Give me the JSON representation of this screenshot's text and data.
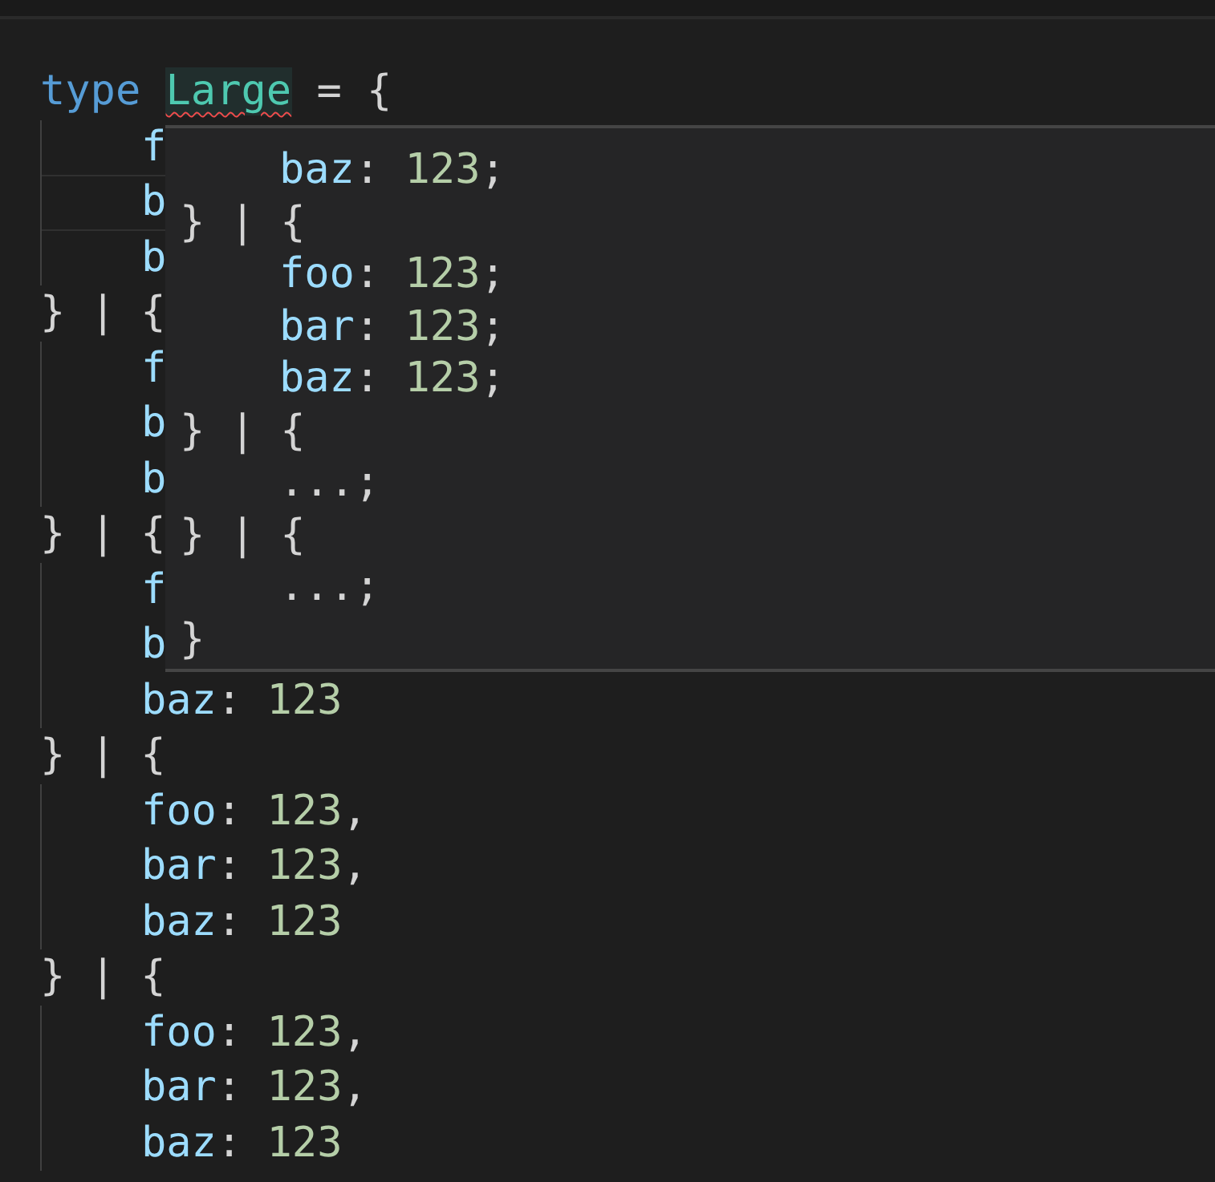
{
  "editor": {
    "lines": [
      {
        "indent": false,
        "tokens": [
          {
            "kind": "keyword",
            "text": "type "
          },
          {
            "kind": "type",
            "text": "Large",
            "highlighted": true,
            "error": true
          },
          {
            "kind": "punct",
            "text": " = {"
          }
        ]
      },
      {
        "indent": true,
        "tokens": [
          {
            "kind": "prop",
            "text": "f"
          }
        ]
      },
      {
        "indent": true,
        "current": true,
        "tokens": [
          {
            "kind": "prop",
            "text": "b"
          }
        ]
      },
      {
        "indent": true,
        "tokens": [
          {
            "kind": "prop",
            "text": "b"
          }
        ]
      },
      {
        "indent": false,
        "tokens": [
          {
            "kind": "punct",
            "text": "} | {"
          }
        ]
      },
      {
        "indent": true,
        "tokens": [
          {
            "kind": "prop",
            "text": "f"
          }
        ]
      },
      {
        "indent": true,
        "tokens": [
          {
            "kind": "prop",
            "text": "b"
          }
        ]
      },
      {
        "indent": true,
        "tokens": [
          {
            "kind": "prop",
            "text": "b"
          }
        ]
      },
      {
        "indent": false,
        "tokens": [
          {
            "kind": "punct",
            "text": "} | {"
          }
        ]
      },
      {
        "indent": true,
        "tokens": [
          {
            "kind": "prop",
            "text": "f"
          }
        ]
      },
      {
        "indent": true,
        "tokens": [
          {
            "kind": "prop",
            "text": "b"
          }
        ]
      },
      {
        "indent": true,
        "tokens": [
          {
            "kind": "prop",
            "text": "baz"
          },
          {
            "kind": "punct",
            "text": ": "
          },
          {
            "kind": "number",
            "text": "123"
          }
        ]
      },
      {
        "indent": false,
        "tokens": [
          {
            "kind": "punct",
            "text": "} | {"
          }
        ]
      },
      {
        "indent": true,
        "tokens": [
          {
            "kind": "prop",
            "text": "foo"
          },
          {
            "kind": "punct",
            "text": ": "
          },
          {
            "kind": "number",
            "text": "123"
          },
          {
            "kind": "punct",
            "text": ","
          }
        ]
      },
      {
        "indent": true,
        "tokens": [
          {
            "kind": "prop",
            "text": "bar"
          },
          {
            "kind": "punct",
            "text": ": "
          },
          {
            "kind": "number",
            "text": "123"
          },
          {
            "kind": "punct",
            "text": ","
          }
        ]
      },
      {
        "indent": true,
        "tokens": [
          {
            "kind": "prop",
            "text": "baz"
          },
          {
            "kind": "punct",
            "text": ": "
          },
          {
            "kind": "number",
            "text": "123"
          }
        ]
      },
      {
        "indent": false,
        "tokens": [
          {
            "kind": "punct",
            "text": "} | {"
          }
        ]
      },
      {
        "indent": true,
        "tokens": [
          {
            "kind": "prop",
            "text": "foo"
          },
          {
            "kind": "punct",
            "text": ": "
          },
          {
            "kind": "number",
            "text": "123"
          },
          {
            "kind": "punct",
            "text": ","
          }
        ]
      },
      {
        "indent": true,
        "tokens": [
          {
            "kind": "prop",
            "text": "bar"
          },
          {
            "kind": "punct",
            "text": ": "
          },
          {
            "kind": "number",
            "text": "123"
          },
          {
            "kind": "punct",
            "text": ","
          }
        ]
      },
      {
        "indent": true,
        "tokens": [
          {
            "kind": "prop",
            "text": "baz"
          },
          {
            "kind": "punct",
            "text": ": "
          },
          {
            "kind": "number",
            "text": "123"
          }
        ]
      }
    ]
  },
  "hover": {
    "lines": [
      {
        "indent": true,
        "tokens": [
          {
            "kind": "prop",
            "text": "baz"
          },
          {
            "kind": "punct",
            "text": ": "
          },
          {
            "kind": "number",
            "text": "123"
          },
          {
            "kind": "punct",
            "text": ";"
          }
        ]
      },
      {
        "indent": false,
        "tokens": [
          {
            "kind": "punct",
            "text": "} | {"
          }
        ]
      },
      {
        "indent": true,
        "tokens": [
          {
            "kind": "prop",
            "text": "foo"
          },
          {
            "kind": "punct",
            "text": ": "
          },
          {
            "kind": "number",
            "text": "123"
          },
          {
            "kind": "punct",
            "text": ";"
          }
        ]
      },
      {
        "indent": true,
        "tokens": [
          {
            "kind": "prop",
            "text": "bar"
          },
          {
            "kind": "punct",
            "text": ": "
          },
          {
            "kind": "number",
            "text": "123"
          },
          {
            "kind": "punct",
            "text": ";"
          }
        ]
      },
      {
        "indent": true,
        "tokens": [
          {
            "kind": "prop",
            "text": "baz"
          },
          {
            "kind": "punct",
            "text": ": "
          },
          {
            "kind": "number",
            "text": "123"
          },
          {
            "kind": "punct",
            "text": ";"
          }
        ]
      },
      {
        "indent": false,
        "tokens": [
          {
            "kind": "punct",
            "text": "} | {"
          }
        ]
      },
      {
        "indent": true,
        "tokens": [
          {
            "kind": "punct",
            "text": "...;"
          }
        ]
      },
      {
        "indent": false,
        "tokens": [
          {
            "kind": "punct",
            "text": "} | {"
          }
        ]
      },
      {
        "indent": true,
        "tokens": [
          {
            "kind": "punct",
            "text": "...;"
          }
        ]
      },
      {
        "indent": false,
        "tokens": [
          {
            "kind": "punct",
            "text": "}"
          }
        ]
      }
    ]
  }
}
